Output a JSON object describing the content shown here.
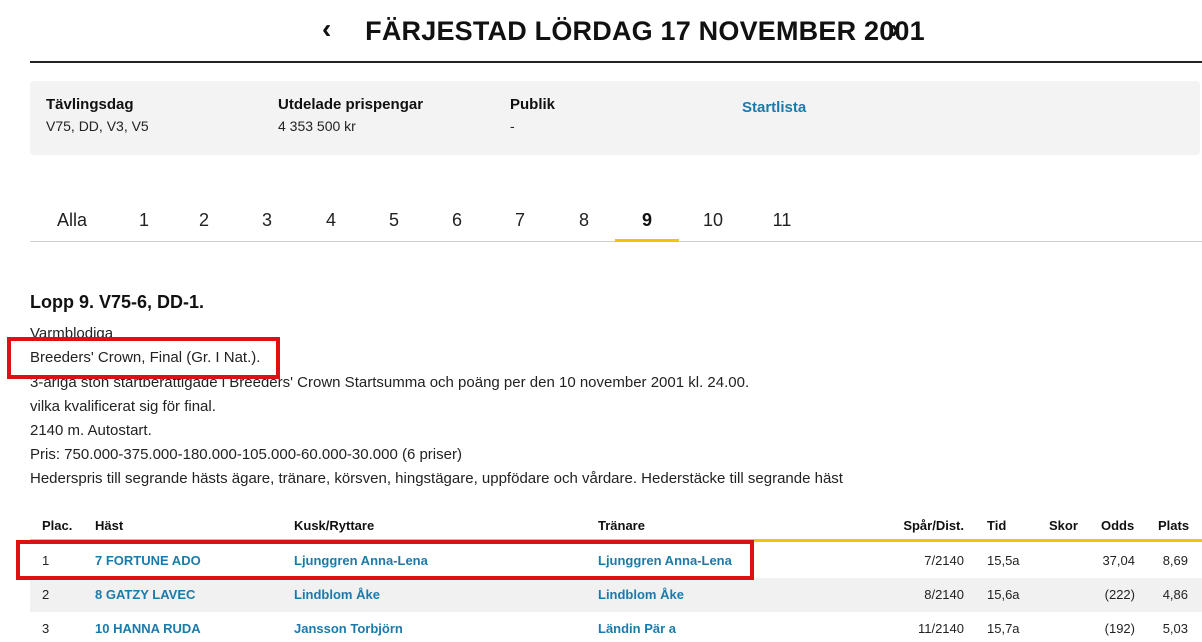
{
  "header": {
    "prev_icon": "‹",
    "title": "FÄRJESTAD LÖRDAG 17 NOVEMBER 2001",
    "next_icon": "›"
  },
  "info": {
    "tavlingsdag_label": "Tävlingsdag",
    "tavlingsdag_value": "V75, DD, V3, V5",
    "prispengar_label": "Utdelade prispengar",
    "prispengar_value": "4 353 500 kr",
    "publik_label": "Publik",
    "publik_value": "-",
    "startlista_link": "Startlista"
  },
  "tabs": [
    "Alla",
    "1",
    "2",
    "3",
    "4",
    "5",
    "6",
    "7",
    "8",
    "9",
    "10",
    "11"
  ],
  "race": {
    "title": "Lopp 9. V75-6, DD-1.",
    "lines": [
      "Varmblodiga",
      "Breeders' Crown, Final (Gr. I Nat.).",
      "3-åriga ston startberättigade i Breeders' Crown Startsumma och poäng per den 10 november 2001 kl. 24.00.",
      "vilka kvalificerat sig för final.",
      "2140 m. Autostart.",
      "Pris: 750.000-375.000-180.000-105.000-60.000-30.000 (6 priser)",
      "Hederspris till segrande hästs ägare, tränare, körsven, hingstägare, uppfödare och vårdare. Hederstäcke till segrande häst"
    ]
  },
  "table": {
    "headers": {
      "plac": "Plac.",
      "hast": "Häst",
      "kusk": "Kusk/Ryttare",
      "tranare": "Tränare",
      "spar": "Spår/Dist.",
      "tid": "Tid",
      "skor": "Skor",
      "odds": "Odds",
      "plats": "Plats"
    },
    "rows": [
      {
        "plac": "1",
        "hast": "7 FORTUNE ADO",
        "kusk": "Ljunggren Anna-Lena",
        "tranare": "Ljunggren Anna-Lena",
        "spar": "7/2140",
        "tid": "15,5a",
        "skor": "",
        "odds": "37,04",
        "plats": "8,69"
      },
      {
        "plac": "2",
        "hast": "8 GATZY LAVEC",
        "kusk": "Lindblom Åke",
        "tranare": "Lindblom Åke",
        "spar": "8/2140",
        "tid": "15,6a",
        "skor": "",
        "odds": "(222)",
        "plats": "4,86"
      },
      {
        "plac": "3",
        "hast": "10 HANNA RUDA",
        "kusk": "Jansson Torbjörn",
        "tranare": "Ländin Pär a",
        "spar": "11/2140",
        "tid": "15,7a",
        "skor": "",
        "odds": "(192)",
        "plats": "5,03"
      }
    ]
  },
  "colors": {
    "link": "#1a7bab",
    "accent": "#f2c500",
    "highlight": "#e01010"
  }
}
